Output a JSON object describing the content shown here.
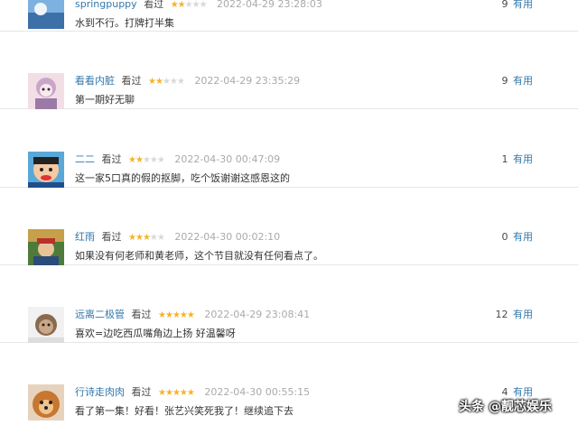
{
  "reviews": [
    {
      "user": "springpuppy",
      "status": "看过",
      "rating": 2,
      "date": "2022-04-29 23:28:03",
      "votes": "9",
      "useful_label": "有用",
      "text": "水到不行。打牌打半集"
    },
    {
      "user": "看看内脏",
      "status": "看过",
      "rating": 2,
      "date": "2022-04-29 23:35:29",
      "votes": "9",
      "useful_label": "有用",
      "text": "第一期好无聊"
    },
    {
      "user": "二二",
      "status": "看过",
      "rating": 2,
      "date": "2022-04-30 00:47:09",
      "votes": "1",
      "useful_label": "有用",
      "text": "这一家5口真的假的抠脚，吃个饭谢谢这感恩这的"
    },
    {
      "user": "红雨",
      "status": "看过",
      "rating": 3,
      "date": "2022-04-30 00:02:10",
      "votes": "0",
      "useful_label": "有用",
      "text": "如果没有何老师和黄老师，这个节目就没有任何看点了。"
    },
    {
      "user": "远离二极管",
      "status": "看过",
      "rating": 5,
      "date": "2022-04-29 23:08:41",
      "votes": "12",
      "useful_label": "有用",
      "text": "喜欢=边吃西瓜嘴角边上扬 好温馨呀"
    },
    {
      "user": "行诗走肉肉",
      "status": "看过",
      "rating": 5,
      "date": "2022-04-30 00:55:15",
      "votes": "4",
      "useful_label": "有用",
      "text": "看了第一集！好看！张艺兴笑死我了！继续追下去"
    }
  ],
  "watermark": "头条 @靓芯娱乐",
  "colors": {
    "link": "#3377aa",
    "star_on": "#f4b32b",
    "star_off": "#d8d8d8",
    "date": "#aaaaaa"
  }
}
